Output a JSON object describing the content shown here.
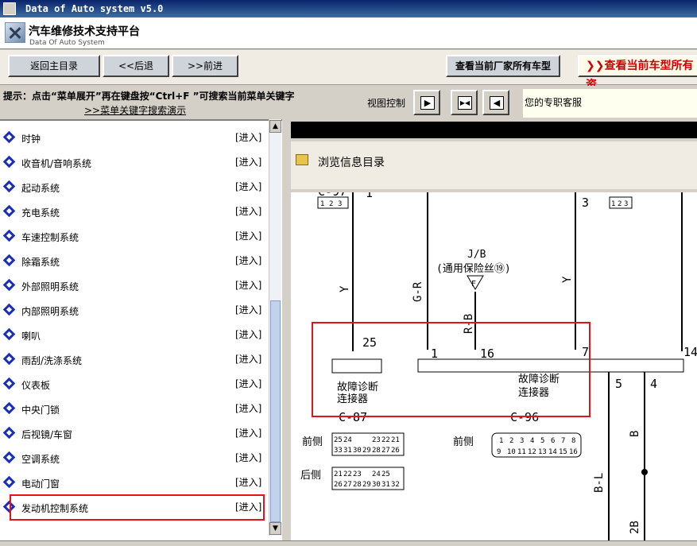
{
  "window": {
    "title": "Data of Auto system v5.0"
  },
  "header": {
    "brand": "汽车维修技术支持平台",
    "brand_sub": "Data Of Auto System"
  },
  "toolbar": {
    "main_menu": "返回主目录",
    "back": "<<后退",
    "forward": ">>前进",
    "all_makers": "查看当前厂家所有车型",
    "all_models": "查看当前车型所有资"
  },
  "hint": {
    "text": "提示：点击“菜单展开”再在键盘按“Ctrl+F ”可搜索当前菜单关键字",
    "link": ">>菜单关键字搜索演示"
  },
  "view_control": {
    "label": "视图控制"
  },
  "support": {
    "text": "您的专职客服"
  },
  "sidebar": {
    "enter_label": "[进入]",
    "items": [
      {
        "label": "时钟"
      },
      {
        "label": "收音机/音响系统"
      },
      {
        "label": "起动系统"
      },
      {
        "label": "充电系统"
      },
      {
        "label": "车速控制系统"
      },
      {
        "label": "除霜系统"
      },
      {
        "label": "外部照明系统"
      },
      {
        "label": "内部照明系统"
      },
      {
        "label": "喇叭"
      },
      {
        "label": "雨刮/洗涤系统"
      },
      {
        "label": "仪表板"
      },
      {
        "label": "中央门锁"
      },
      {
        "label": "后视镜/车窗"
      },
      {
        "label": "空调系统"
      },
      {
        "label": "电动门窗"
      },
      {
        "label": "发动机控制系统"
      }
    ]
  },
  "browse": {
    "title": "浏览信息目录"
  },
  "diagram": {
    "labels": {
      "c97": "C-97",
      "pin1": "1",
      "pin3": "3",
      "jb": "J/B",
      "fuse": "(通用保险丝⑲)",
      "f": "F",
      "wy1": "Y",
      "wgr": "G-R",
      "wrb": "R-B",
      "wy2": "Y",
      "n25": "25",
      "n1": "1",
      "n16": "16",
      "n7": "7",
      "n14": "14",
      "n5": "5",
      "n4": "4",
      "diag1a": "故障诊断",
      "diag1b": "连接器",
      "diag2a": "故障诊断",
      "diag2b": "连接器",
      "c87": "C-87",
      "c96": "C-96",
      "front1": "前侧",
      "back1": "后侧",
      "front2": "前侧",
      "wb": "B",
      "wbl": "B-L",
      "w2b": "2B"
    },
    "conn_small": [
      "1",
      "2",
      "3"
    ],
    "c87_front": [
      "25",
      "24",
      "",
      "",
      "23",
      "22",
      "21",
      "",
      "",
      "",
      "",
      "",
      "",
      ""
    ],
    "c87_front_row2": [
      "33",
      "31",
      "30",
      "29",
      "28",
      "27",
      "26"
    ],
    "c87_back_row1": [
      "21",
      "22",
      "23",
      "",
      "24",
      "25"
    ],
    "c87_back_row2": [
      "26",
      "27",
      "28",
      "29",
      "30",
      "31",
      "32"
    ],
    "c96_row1": [
      "1",
      "2",
      "3",
      "4",
      "5",
      "6",
      "7",
      "8"
    ],
    "c96_row2": [
      "9",
      "10",
      "11",
      "12",
      "13",
      "14",
      "15",
      "16"
    ]
  }
}
